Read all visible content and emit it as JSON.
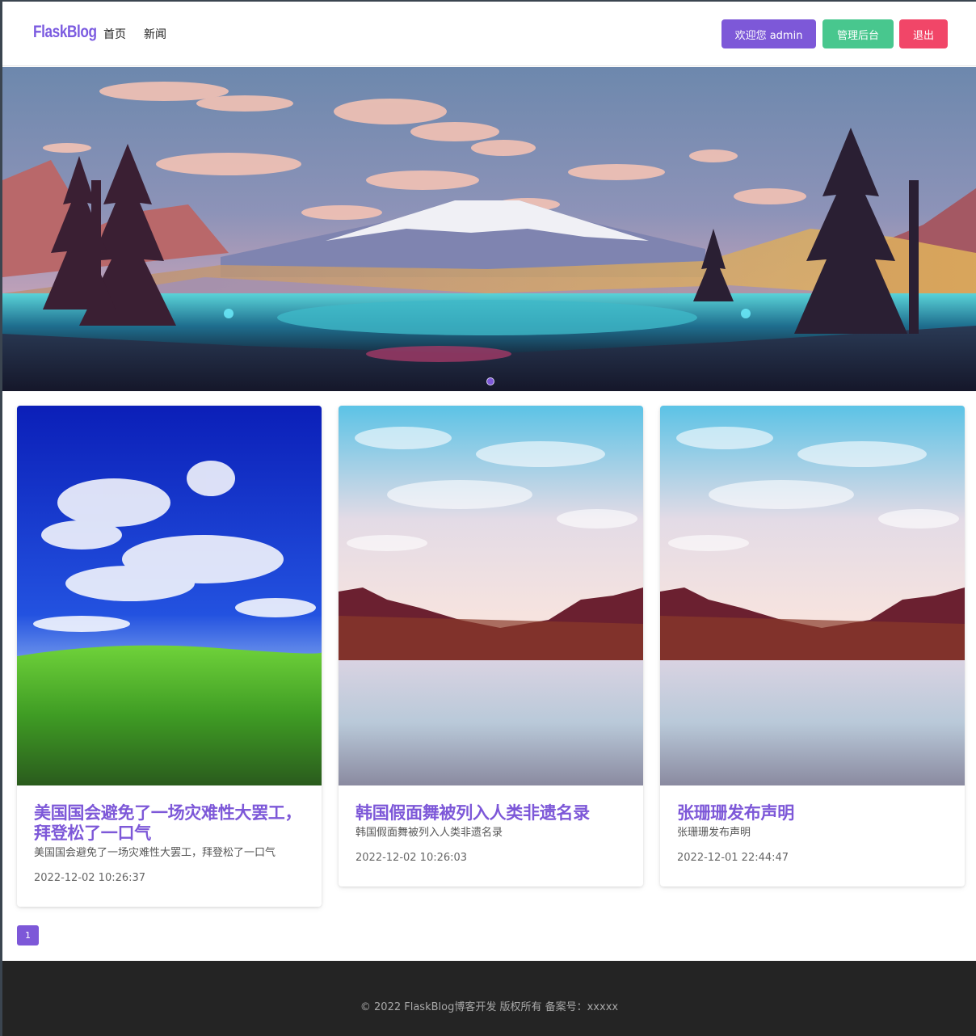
{
  "brand": {
    "logo_text": "FlaskBlog"
  },
  "nav": {
    "links": [
      {
        "label": "首页"
      },
      {
        "label": "新闻"
      }
    ],
    "buttons": {
      "welcome_label": "欢迎您 admin",
      "admin_label": "管理后台",
      "logout_label": "退出"
    }
  },
  "colors": {
    "accent": "#7d58d8",
    "admin_button": "#48c78e",
    "logout_button": "#f14668",
    "footer_bg": "#242424"
  },
  "carousel": {
    "slides": 1,
    "active_index": 0
  },
  "posts": [
    {
      "title": "美国国会避免了一场灾难性大罢工，拜登松了一口气",
      "summary": "美国国会避免了一场灾难性大罢工，拜登松了一口气",
      "date": "2022-12-02 10:26:37"
    },
    {
      "title": "韩国假面舞被列入人类非遗名录",
      "summary": "韩国假面舞被列入人类非遗名录",
      "date": "2022-12-02 10:26:03"
    },
    {
      "title": "张珊珊发布声明",
      "summary": "张珊珊发布声明",
      "date": "2022-12-01 22:44:47"
    }
  ],
  "pagination": {
    "current_page": "1"
  },
  "footer": {
    "text": "© 2022 FlaskBlog博客开发 版权所有 备案号：xxxxx"
  }
}
